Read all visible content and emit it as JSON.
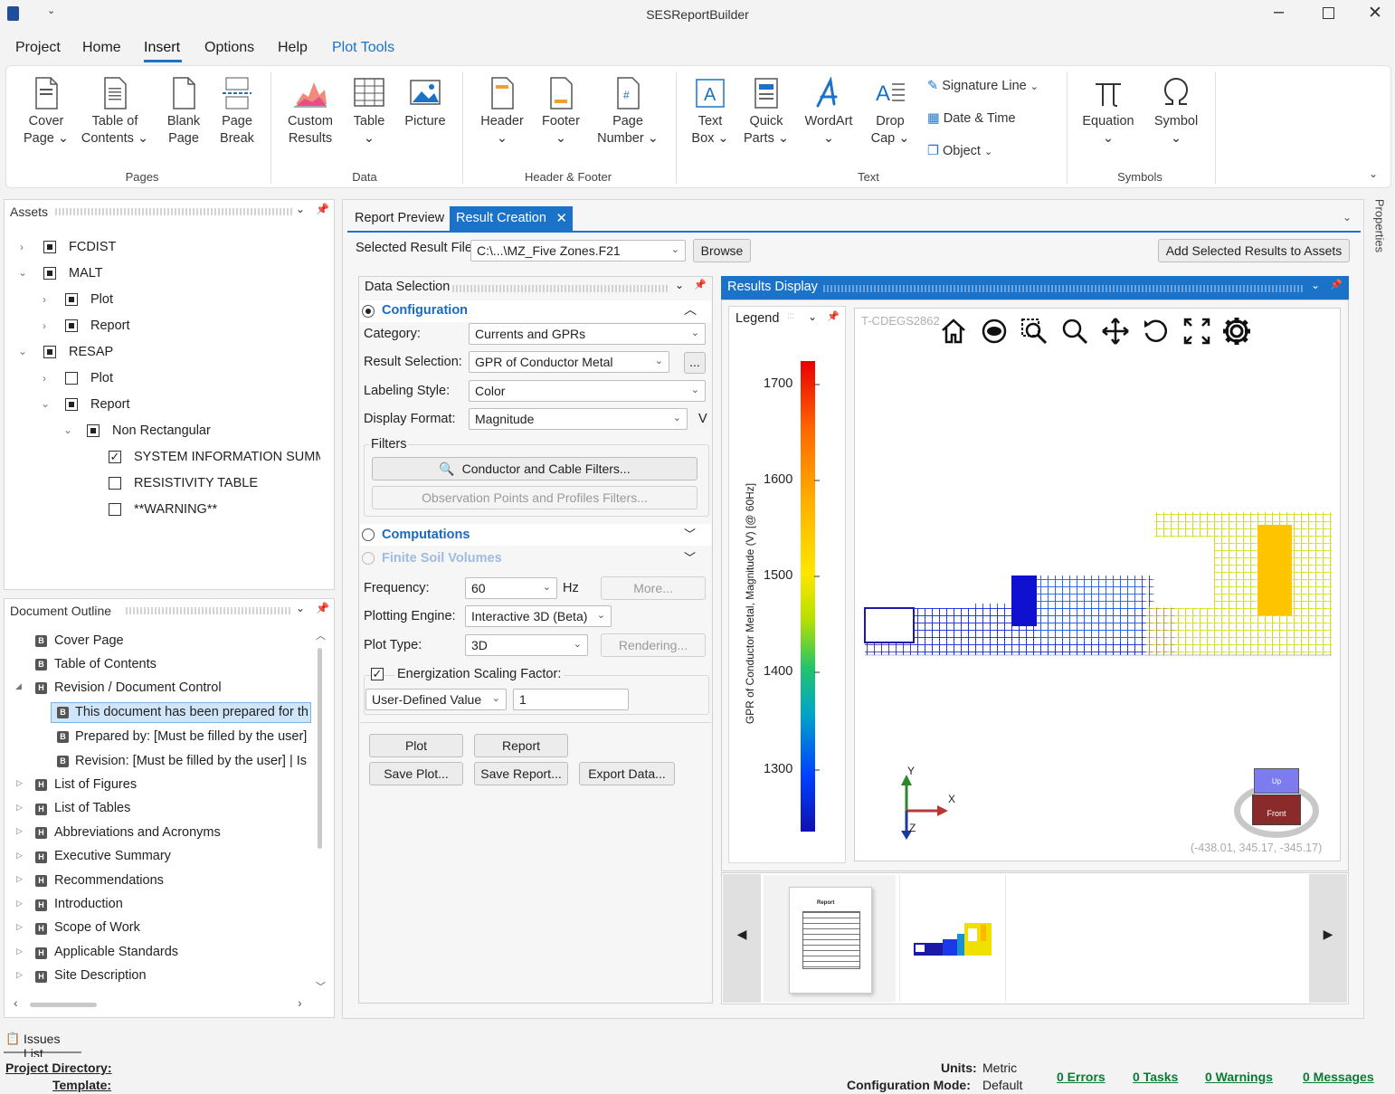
{
  "app": {
    "title": "SESReportBuilder"
  },
  "menu": [
    "Project",
    "Home",
    "Insert",
    "Options",
    "Help",
    "Plot Tools"
  ],
  "ribbon": {
    "pages": {
      "label": "Pages",
      "cover": "Cover\nPage ⌄",
      "toc": "Table of\nContents ⌄",
      "blank": "Blank\nPage",
      "break": "Page\nBreak"
    },
    "data": {
      "label": "Data",
      "custom": "Custom\nResults",
      "table": "Table\n⌄",
      "picture": "Picture"
    },
    "hf": {
      "label": "Header & Footer",
      "header": "Header\n⌄",
      "footer": "Footer\n⌄",
      "pagenum": "Page\nNumber ⌄"
    },
    "text": {
      "label": "Text",
      "textbox": "Text\nBox ⌄",
      "quick": "Quick\nParts ⌄",
      "wordart": "WordArt\n⌄",
      "dropcap": "Drop\nCap ⌄",
      "sig": "Signature Line",
      "date": "Date & Time",
      "object": "Object"
    },
    "symbols": {
      "label": "Symbols",
      "equation": "Equation\n⌄",
      "symbol": "Symbol\n⌄"
    }
  },
  "assets": {
    "title": "Assets",
    "rows": [
      "FCDIST",
      "MALT",
      "Plot",
      "Report",
      "RESAP",
      "Plot",
      "Report",
      "Non Rectangular",
      "SYSTEM INFORMATION SUMMA",
      "RESISTIVITY TABLE",
      "**WARNING**"
    ]
  },
  "outline": {
    "title": "Document Outline",
    "rows": [
      "Cover Page",
      "Table of Contents",
      "Revision / Document Control",
      "This document has been prepared for th",
      "Prepared by: [Must be filled by the user]",
      "Revision: [Must be filled by the user]  |  Is",
      "List of Figures",
      "List of Tables",
      "Abbreviations and Acronyms",
      "Executive Summary",
      "Recommendations",
      "Introduction",
      "Scope of Work",
      "Applicable Standards",
      "Site Description"
    ]
  },
  "tabs": {
    "preview": "Report Preview",
    "creation": "Result Creation"
  },
  "file": {
    "label": "Selected Result File:",
    "value": "C:\\...\\MZ_Five Zones.F21",
    "browse": "Browse",
    "add": "Add Selected Results to Assets"
  },
  "ds": {
    "title": "Data Selection",
    "config": "Configuration",
    "category_l": "Category:",
    "category": "Currents and GPRs",
    "result_l": "Result Selection:",
    "result": "GPR of Conductor Metal",
    "label_l": "Labeling Style:",
    "label": "Color",
    "display_l": "Display Format:",
    "display": "Magnitude",
    "unit": "V",
    "filters": "Filters",
    "cond": "Conductor and Cable Filters...",
    "obs": "Observation Points and Profiles Filters...",
    "comp": "Computations",
    "fsv": "Finite Soil Volumes",
    "freq_l": "Frequency:",
    "freq": "60",
    "hz": "Hz",
    "more": "More...",
    "engine_l": "Plotting Engine:",
    "engine": "Interactive 3D (Beta)",
    "ptype_l": "Plot Type:",
    "ptype": "3D",
    "render": "Rendering...",
    "esf": "Energization Scaling Factor:",
    "udv": "User-Defined Value",
    "udv_val": "1",
    "plot": "Plot",
    "report": "Report",
    "saveplot": "Save Plot...",
    "savereport": "Save Report...",
    "export": "Export Data...",
    "dots": "..."
  },
  "results": {
    "title": "Results Display",
    "legend": "Legend",
    "watermark": "T-CDEGS2862",
    "axis_title": "GPR of Conductor Metal, Magnitude (V) [@ 60Hz]",
    "ticks": [
      "1700",
      "1600",
      "1500",
      "1400",
      "1300"
    ],
    "coords": "(-438.01, 345.17, -345.17)",
    "axis_x": "X",
    "axis_y": "Y",
    "axis_z": "Z",
    "cube_up": "Up",
    "cube_front": "Front",
    "thumb_report": "Report"
  },
  "side": {
    "properties": "Properties"
  },
  "issues": "Issues List",
  "status": {
    "projdir": "Project Directory:",
    "template": "Template:",
    "units_l": "Units:",
    "units": "Metric",
    "mode_l": "Configuration Mode:",
    "mode": "Default",
    "errors": "0 Errors",
    "tasks": "0 Tasks",
    "warnings": "0 Warnings",
    "messages": "0 Messages"
  },
  "colors": {
    "accent": "#1a73c8",
    "tab_active": "#1a73c8",
    "link": "#0b7a35"
  }
}
